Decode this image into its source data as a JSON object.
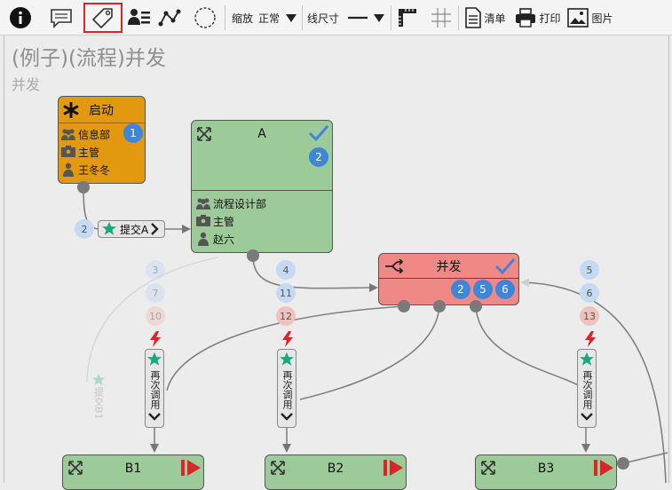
{
  "toolbar": {
    "zoom_label": "缩放",
    "zoom_value": "正常",
    "line_label": "线尺寸",
    "list_label": "清单",
    "print_label": "打印",
    "image_label": "图片"
  },
  "diagram": {
    "title": "(例子)(流程)并发",
    "subtitle": "并发"
  },
  "nodes": {
    "start": {
      "title": "启动",
      "badge": "1",
      "dept": "信息部",
      "role": "主管",
      "user": "王冬冬"
    },
    "a": {
      "title": "A",
      "badge": "2",
      "dept": "流程设计部",
      "role": "主管",
      "user": "赵六"
    },
    "parallel": {
      "title": "并发",
      "badges": [
        "2",
        "5",
        "6"
      ]
    },
    "b1": {
      "title": "B1"
    },
    "b2": {
      "title": "B2"
    },
    "b3": {
      "title": "B3"
    }
  },
  "transitions": {
    "submit_a": {
      "label": "提交A",
      "number": "2"
    },
    "faint": {
      "label": "提交B1",
      "numbers": [
        "3",
        "7",
        "10"
      ]
    },
    "recall_1": {
      "label": "再次调用"
    },
    "recall_2": {
      "label": "再次调用",
      "numbers": [
        "4",
        "11",
        "12"
      ]
    },
    "recall_3": {
      "label": "再次调用",
      "numbers": [
        "5",
        "6",
        "13"
      ]
    }
  },
  "colors": {
    "start": "#e3990f",
    "task": "#9ccb99",
    "parallel": "#f08886",
    "badge": "#3f85d8",
    "accent_check": "#3f85d8",
    "play": "#d9262b"
  }
}
